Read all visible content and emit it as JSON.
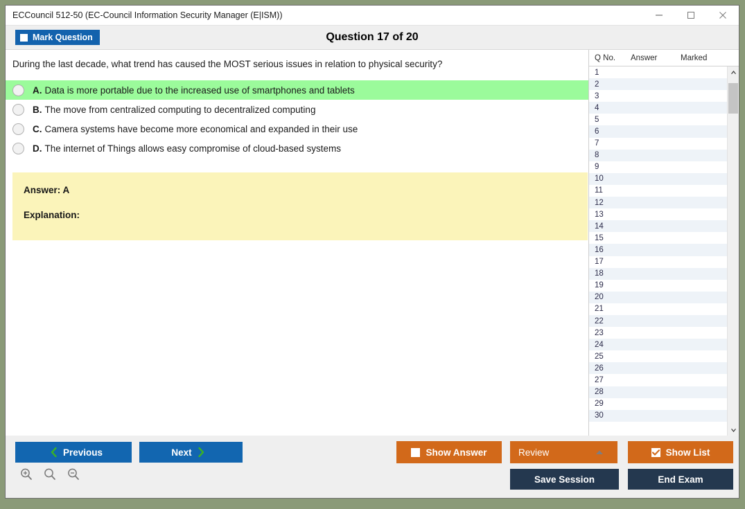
{
  "window": {
    "title": "ECCouncil 512-50 (EC-Council Information Security Manager (E|ISM))",
    "minimize_label": "minimize",
    "maximize_label": "maximize",
    "close_label": "close"
  },
  "header": {
    "mark_question_label": "Mark Question",
    "question_counter": "Question 17 of 20"
  },
  "question": {
    "text": "During the last decade, what trend has caused the MOST serious issues in relation to physical security?",
    "options": [
      {
        "letter": "A.",
        "text": "Data is more portable due to the increased use of smartphones and tablets",
        "highlighted": true
      },
      {
        "letter": "B.",
        "text": "The move from centralized computing to decentralized computing",
        "highlighted": false
      },
      {
        "letter": "C.",
        "text": "Camera systems have become more economical and expanded in their use",
        "highlighted": false
      },
      {
        "letter": "D.",
        "text": "The internet of Things allows easy compromise of cloud-based systems",
        "highlighted": false
      }
    ]
  },
  "answer_panel": {
    "answer_label": "Answer: A",
    "explanation_label": "Explanation:"
  },
  "question_list": {
    "columns": [
      "Q No.",
      "Answer",
      "Marked"
    ],
    "rows": [
      {
        "no": "1",
        "answer": "",
        "marked": ""
      },
      {
        "no": "2",
        "answer": "",
        "marked": ""
      },
      {
        "no": "3",
        "answer": "",
        "marked": ""
      },
      {
        "no": "4",
        "answer": "",
        "marked": ""
      },
      {
        "no": "5",
        "answer": "",
        "marked": ""
      },
      {
        "no": "6",
        "answer": "",
        "marked": ""
      },
      {
        "no": "7",
        "answer": "",
        "marked": ""
      },
      {
        "no": "8",
        "answer": "",
        "marked": ""
      },
      {
        "no": "9",
        "answer": "",
        "marked": ""
      },
      {
        "no": "10",
        "answer": "",
        "marked": ""
      },
      {
        "no": "11",
        "answer": "",
        "marked": ""
      },
      {
        "no": "12",
        "answer": "",
        "marked": ""
      },
      {
        "no": "13",
        "answer": "",
        "marked": ""
      },
      {
        "no": "14",
        "answer": "",
        "marked": ""
      },
      {
        "no": "15",
        "answer": "",
        "marked": ""
      },
      {
        "no": "16",
        "answer": "",
        "marked": ""
      },
      {
        "no": "17",
        "answer": "",
        "marked": ""
      },
      {
        "no": "18",
        "answer": "",
        "marked": ""
      },
      {
        "no": "19",
        "answer": "",
        "marked": ""
      },
      {
        "no": "20",
        "answer": "",
        "marked": ""
      },
      {
        "no": "21",
        "answer": "",
        "marked": ""
      },
      {
        "no": "22",
        "answer": "",
        "marked": ""
      },
      {
        "no": "23",
        "answer": "",
        "marked": ""
      },
      {
        "no": "24",
        "answer": "",
        "marked": ""
      },
      {
        "no": "25",
        "answer": "",
        "marked": ""
      },
      {
        "no": "26",
        "answer": "",
        "marked": ""
      },
      {
        "no": "27",
        "answer": "",
        "marked": ""
      },
      {
        "no": "28",
        "answer": "",
        "marked": ""
      },
      {
        "no": "29",
        "answer": "",
        "marked": ""
      },
      {
        "no": "30",
        "answer": "",
        "marked": ""
      }
    ]
  },
  "footer": {
    "previous_label": "Previous",
    "next_label": "Next",
    "show_answer_label": "Show Answer",
    "show_answer_checked": false,
    "review_label": "Review",
    "show_list_label": "Show List",
    "show_list_checked": true,
    "save_session_label": "Save Session",
    "end_exam_label": "End Exam",
    "zoom_in_label": "zoom-in",
    "zoom_reset_label": "zoom-reset",
    "zoom_out_label": "zoom-out"
  },
  "colors": {
    "accent_blue": "#1266b0",
    "accent_orange": "#d2691a",
    "navy": "#24384f",
    "highlight_green": "#9bfb9b",
    "answer_yellow": "#fbf4ba",
    "chevron_green": "#3cb521"
  }
}
